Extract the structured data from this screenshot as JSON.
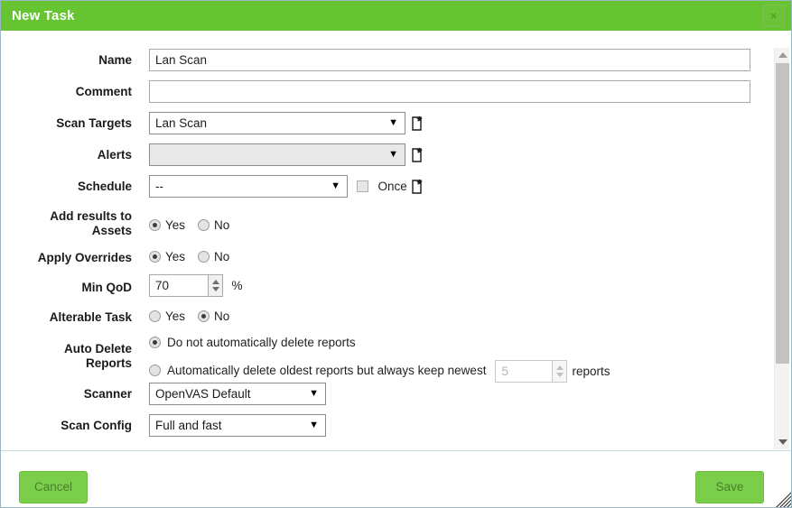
{
  "window": {
    "title": "New Task",
    "close_label": "×",
    "close_icon": "close-icon"
  },
  "colors": {
    "header_green": "#66c430",
    "button_green": "#7ace4a",
    "button_text": "#4a7f2c",
    "border": "#9ab7c4"
  },
  "form": {
    "name": {
      "label": "Name",
      "value": "Lan Scan",
      "placeholder": ""
    },
    "comment": {
      "label": "Comment",
      "value": "",
      "placeholder": ""
    },
    "scan_targets": {
      "label": "Scan Targets",
      "value": "Lan Scan",
      "arrow": "▼",
      "new_icon": "new-item-icon"
    },
    "alerts": {
      "label": "Alerts",
      "value": "",
      "arrow": "▼",
      "new_icon": "new-item-icon"
    },
    "schedule": {
      "label": "Schedule",
      "value": "--",
      "arrow": "▼",
      "once_label": "Once",
      "once_checked": false,
      "new_icon": "new-item-icon"
    },
    "add_results_to_assets": {
      "label": "Add results to Assets",
      "label_line1": "Add results to",
      "label_line2": "Assets",
      "yes_label": "Yes",
      "no_label": "No",
      "selected": "Yes"
    },
    "apply_overrides": {
      "label": "Apply Overrides",
      "yes_label": "Yes",
      "no_label": "No",
      "selected": "Yes"
    },
    "min_qod": {
      "label": "Min QoD",
      "value": "70",
      "suffix": "%"
    },
    "alterable_task": {
      "label": "Alterable Task",
      "yes_label": "Yes",
      "no_label": "No",
      "selected": "No"
    },
    "auto_delete_reports": {
      "label": "Auto Delete Reports",
      "label_line1": "Auto Delete",
      "label_line2": "Reports",
      "option_keep_label": "Do not automatically delete reports",
      "option_delete_label": "Automatically delete oldest reports but always keep newest",
      "selected": "Do not automatically delete reports",
      "keep_count": "5",
      "keep_count_suffix": "reports"
    },
    "scanner": {
      "label": "Scanner",
      "value": "OpenVAS Default",
      "arrow": "▼"
    },
    "scan_config": {
      "label": "Scan Config",
      "value": "Full and fast",
      "arrow": "▼"
    }
  },
  "footer": {
    "cancel_label": "Cancel",
    "save_label": "Save"
  }
}
